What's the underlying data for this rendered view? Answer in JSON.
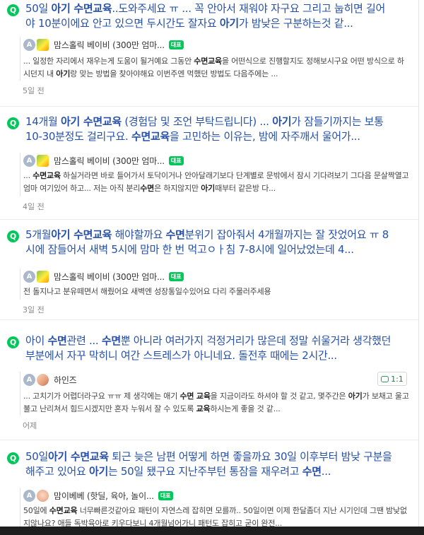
{
  "results": [
    {
      "title_parts": [
        {
          "t": "50일 ",
          "hl": false
        },
        {
          "t": "아기 수면교육",
          "hl": true
        },
        {
          "t": "..도와주세요 ㅠ ... 꼭 안아서 재워야 자구요 그리고 눕히면 길어야 10분이에요 안고 있으면 두시간도 잘자요 ",
          "hl": false
        },
        {
          "t": "아기",
          "hl": true
        },
        {
          "t": "가 밤낮은 구분하는것 같...",
          "hl": false
        }
      ],
      "nickname": "맘스홀릭 베이비 (300만 엄마...",
      "avatar_letter": "A",
      "avatar_kind": "cafe",
      "expert_badge": "대표",
      "snippet_parts": [
        {
          "t": "... 일정한 자리에서 재우는게 도움이 될거예요 그동안 ",
          "hl": false
        },
        {
          "t": "수면교육",
          "hl": true
        },
        {
          "t": "을 어떤식으로 진행할지도 정해보시구요 어떤 방식으로 하시던지 내 ",
          "hl": false
        },
        {
          "t": "아기",
          "hl": true
        },
        {
          "t": "랑 맞는 방법을 찾아야해요 이번주엔 먹했던 방법도 다음주에는 ...",
          "hl": false
        }
      ],
      "date": "5일 전",
      "comment_count": ""
    },
    {
      "title_parts": [
        {
          "t": "14개월 ",
          "hl": false
        },
        {
          "t": "아기 수면교육",
          "hl": true
        },
        {
          "t": " (경험담 및 조언 부탁드립니다) ... ",
          "hl": false
        },
        {
          "t": "아기",
          "hl": true
        },
        {
          "t": "가 잠들기까지는 보통 10-30분정도 걸리구요. ",
          "hl": false
        },
        {
          "t": "수면교육",
          "hl": true
        },
        {
          "t": "을 고민하는 이유는, 밤에 자주깨서 울어가...",
          "hl": false
        }
      ],
      "nickname": "맘스홀릭 베이비 (300만 엄마...",
      "avatar_letter": "A",
      "avatar_kind": "cafe",
      "expert_badge": "대표",
      "snippet_parts": [
        {
          "t": "... ",
          "hl": false
        },
        {
          "t": "수면교육",
          "hl": true
        },
        {
          "t": " 하실거라면 바로 들어가서 토닥이거나 안아달래기보다 단계별로 문밖에서 잠시 기다려보기 그다음 문살짝열고 엄마 여기있어 하고... 저는 아직 분리",
          "hl": false
        },
        {
          "t": "수면",
          "hl": true
        },
        {
          "t": "은 하지않지만 ",
          "hl": false
        },
        {
          "t": "아기",
          "hl": true
        },
        {
          "t": "때부터 같은방 다...",
          "hl": false
        }
      ],
      "date": "4일 전",
      "comment_count": ""
    },
    {
      "title_parts": [
        {
          "t": "5개월",
          "hl": false
        },
        {
          "t": "아기 수면교육",
          "hl": true
        },
        {
          "t": " 해야할까요 ",
          "hl": false
        },
        {
          "t": "수면",
          "hl": true
        },
        {
          "t": "분위기 잡아줘서 4개월까지는 잘 잣었어요 ㅠ 8시에 잠들어서 새벽 5시에 맘마 한 번 먹고ㅇㅏ침 7-8시에 일어났었는데 4...",
          "hl": false
        }
      ],
      "nickname": "맘스홀릭 베이비 (300만 엄마...",
      "avatar_letter": "A",
      "avatar_kind": "cafe",
      "expert_badge": "대표",
      "snippet_parts": [
        {
          "t": "전 돌지나고 분유떼면서 해줬어요 새벽엔 성장통일수있어요 다리 주물러주세용",
          "hl": false
        }
      ],
      "date": "3일 전",
      "comment_count": ""
    },
    {
      "title_parts": [
        {
          "t": "아이 ",
          "hl": false
        },
        {
          "t": "수면",
          "hl": true
        },
        {
          "t": "관련 ... ",
          "hl": false
        },
        {
          "t": "수면",
          "hl": true
        },
        {
          "t": "뿐 아니라 여러가지 걱정거리가 많은데 정말 쉬울거라 생각했던 부분에서 자꾸 막히니 여간 스트레스가 아니네요. 돌전후 때에는 2시간...",
          "hl": false
        }
      ],
      "nickname": "하인즈",
      "avatar_letter": "A",
      "avatar_kind": "person",
      "expert_badge": "",
      "snippet_parts": [
        {
          "t": "... 고치기가 어렵더라구요 ㅠㅠ 제 생각에는 애기 ",
          "hl": false
        },
        {
          "t": "수면 교육",
          "hl": true
        },
        {
          "t": "을 지금이라도 하셔야 할 것 같고, 몇주간은 ",
          "hl": false
        },
        {
          "t": "아기",
          "hl": true
        },
        {
          "t": "가 보채고 울고불고 난리쳐서 힘드시겠지만 혼자 누워서 잘 수 있도록 ",
          "hl": false
        },
        {
          "t": "교육",
          "hl": true
        },
        {
          "t": "하시는게 좋을 것 같...",
          "hl": false
        }
      ],
      "date": "어제",
      "comment_count": "1:1"
    },
    {
      "title_parts": [
        {
          "t": "50일",
          "hl": false
        },
        {
          "t": "아기 수면교육",
          "hl": true
        },
        {
          "t": " 퇴근 늦은 남편 어떻게 하면 좋을까요 30일 이후부터 밤낮 구분을 해주고 있어요 ",
          "hl": false
        },
        {
          "t": "아기",
          "hl": true
        },
        {
          "t": "는 50일 됐구요 지난주부턴 통잠을 재우려고 ",
          "hl": false
        },
        {
          "t": "수면",
          "hl": true
        },
        {
          "t": "...",
          "hl": false
        }
      ],
      "nickname": "맘이베베 (핫딜, 육아, 놀이...",
      "avatar_letter": "A",
      "avatar_kind": "baby",
      "expert_badge": "대표",
      "snippet_parts": [
        {
          "t": "50일에 ",
          "hl": false
        },
        {
          "t": "수면교육",
          "hl": true
        },
        {
          "t": " 너무빠른것같아요 패턴이 자연스레 잡히면 모를까.. 50일이면 이제 한달좀더 지난 시기인데 그땐 밤낮없지않나요? 애들 독박육아로 키우다보니 4개월넘어가니 패턴도 잡히고 굳이 완전...",
          "hl": false
        }
      ],
      "date": "",
      "comment_count": ""
    }
  ]
}
